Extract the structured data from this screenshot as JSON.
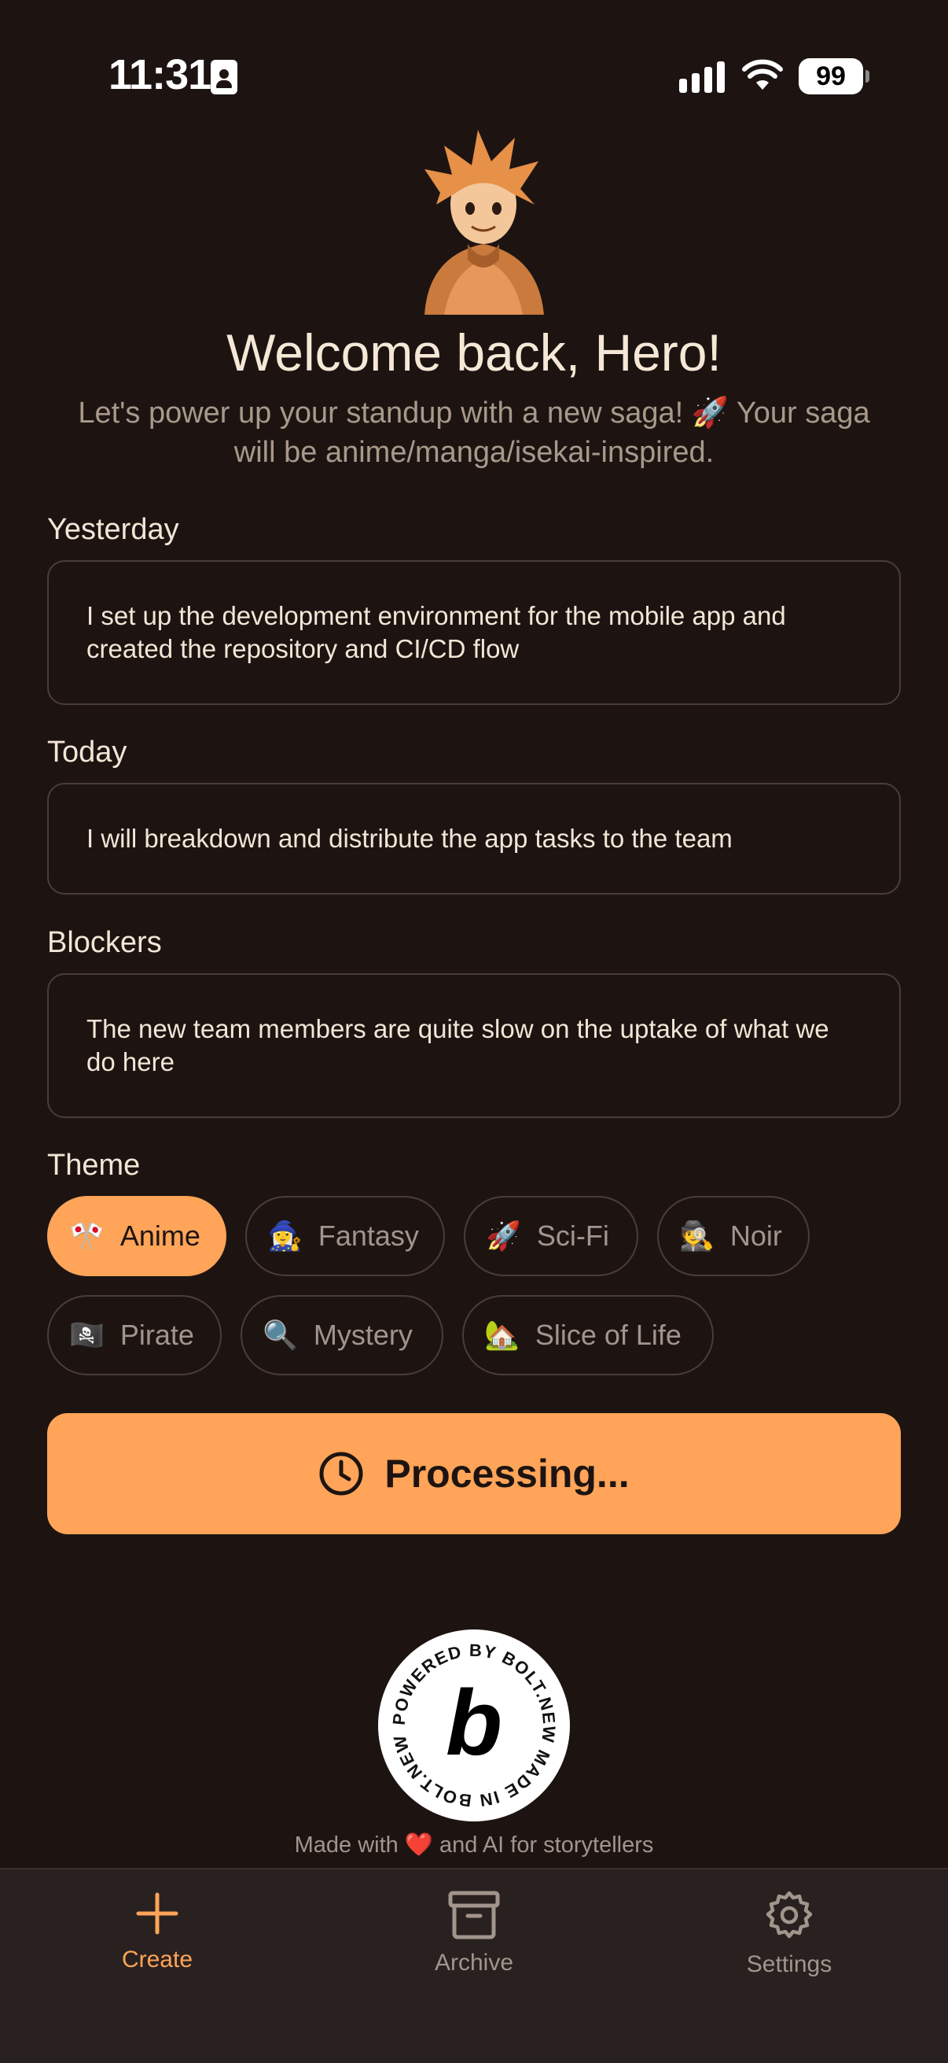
{
  "status_bar": {
    "time": "11:31",
    "battery": "99"
  },
  "header": {
    "title": "Welcome back, Hero!",
    "subtitle": "Let's power up your standup with a new saga! 🚀 Your saga will be anime/manga/isekai-inspired."
  },
  "form": {
    "yesterday": {
      "label": "Yesterday",
      "value": "I set up the development environment for the mobile app and created the repository and CI/CD flow"
    },
    "today": {
      "label": "Today",
      "value": "I will breakdown and distribute the app tasks to the team"
    },
    "blockers": {
      "label": "Blockers",
      "value": "The new team members are quite slow on the uptake of what we do here"
    },
    "theme": {
      "label": "Theme",
      "selected": "Anime",
      "options": [
        {
          "emoji": "🎌",
          "label": "Anime"
        },
        {
          "emoji": "🧙‍♀️",
          "label": "Fantasy"
        },
        {
          "emoji": "🚀",
          "label": "Sci-Fi"
        },
        {
          "emoji": "🕵️",
          "label": "Noir"
        },
        {
          "emoji": "🏴‍☠️",
          "label": "Pirate"
        },
        {
          "emoji": "🔍",
          "label": "Mystery"
        },
        {
          "emoji": "🏡",
          "label": "Slice of Life"
        }
      ]
    }
  },
  "submit": {
    "label": "Processing...",
    "icon": "clock-icon"
  },
  "badge": {
    "ring_text": "POWERED BY BOLT.NEW MADE IN BOLT.NEW",
    "letter": "b"
  },
  "footer": {
    "note": "Made with ❤️ and AI for storytellers"
  },
  "tab_bar": {
    "tabs": [
      {
        "label": "Create",
        "icon": "plus-icon",
        "active": true
      },
      {
        "label": "Archive",
        "icon": "archive-icon",
        "active": false
      },
      {
        "label": "Settings",
        "icon": "gear-icon",
        "active": false
      }
    ]
  },
  "colors": {
    "background": "#1d1412",
    "accent": "#ffa458",
    "muted_text": "#a1958c",
    "border": "#4a3d37"
  }
}
